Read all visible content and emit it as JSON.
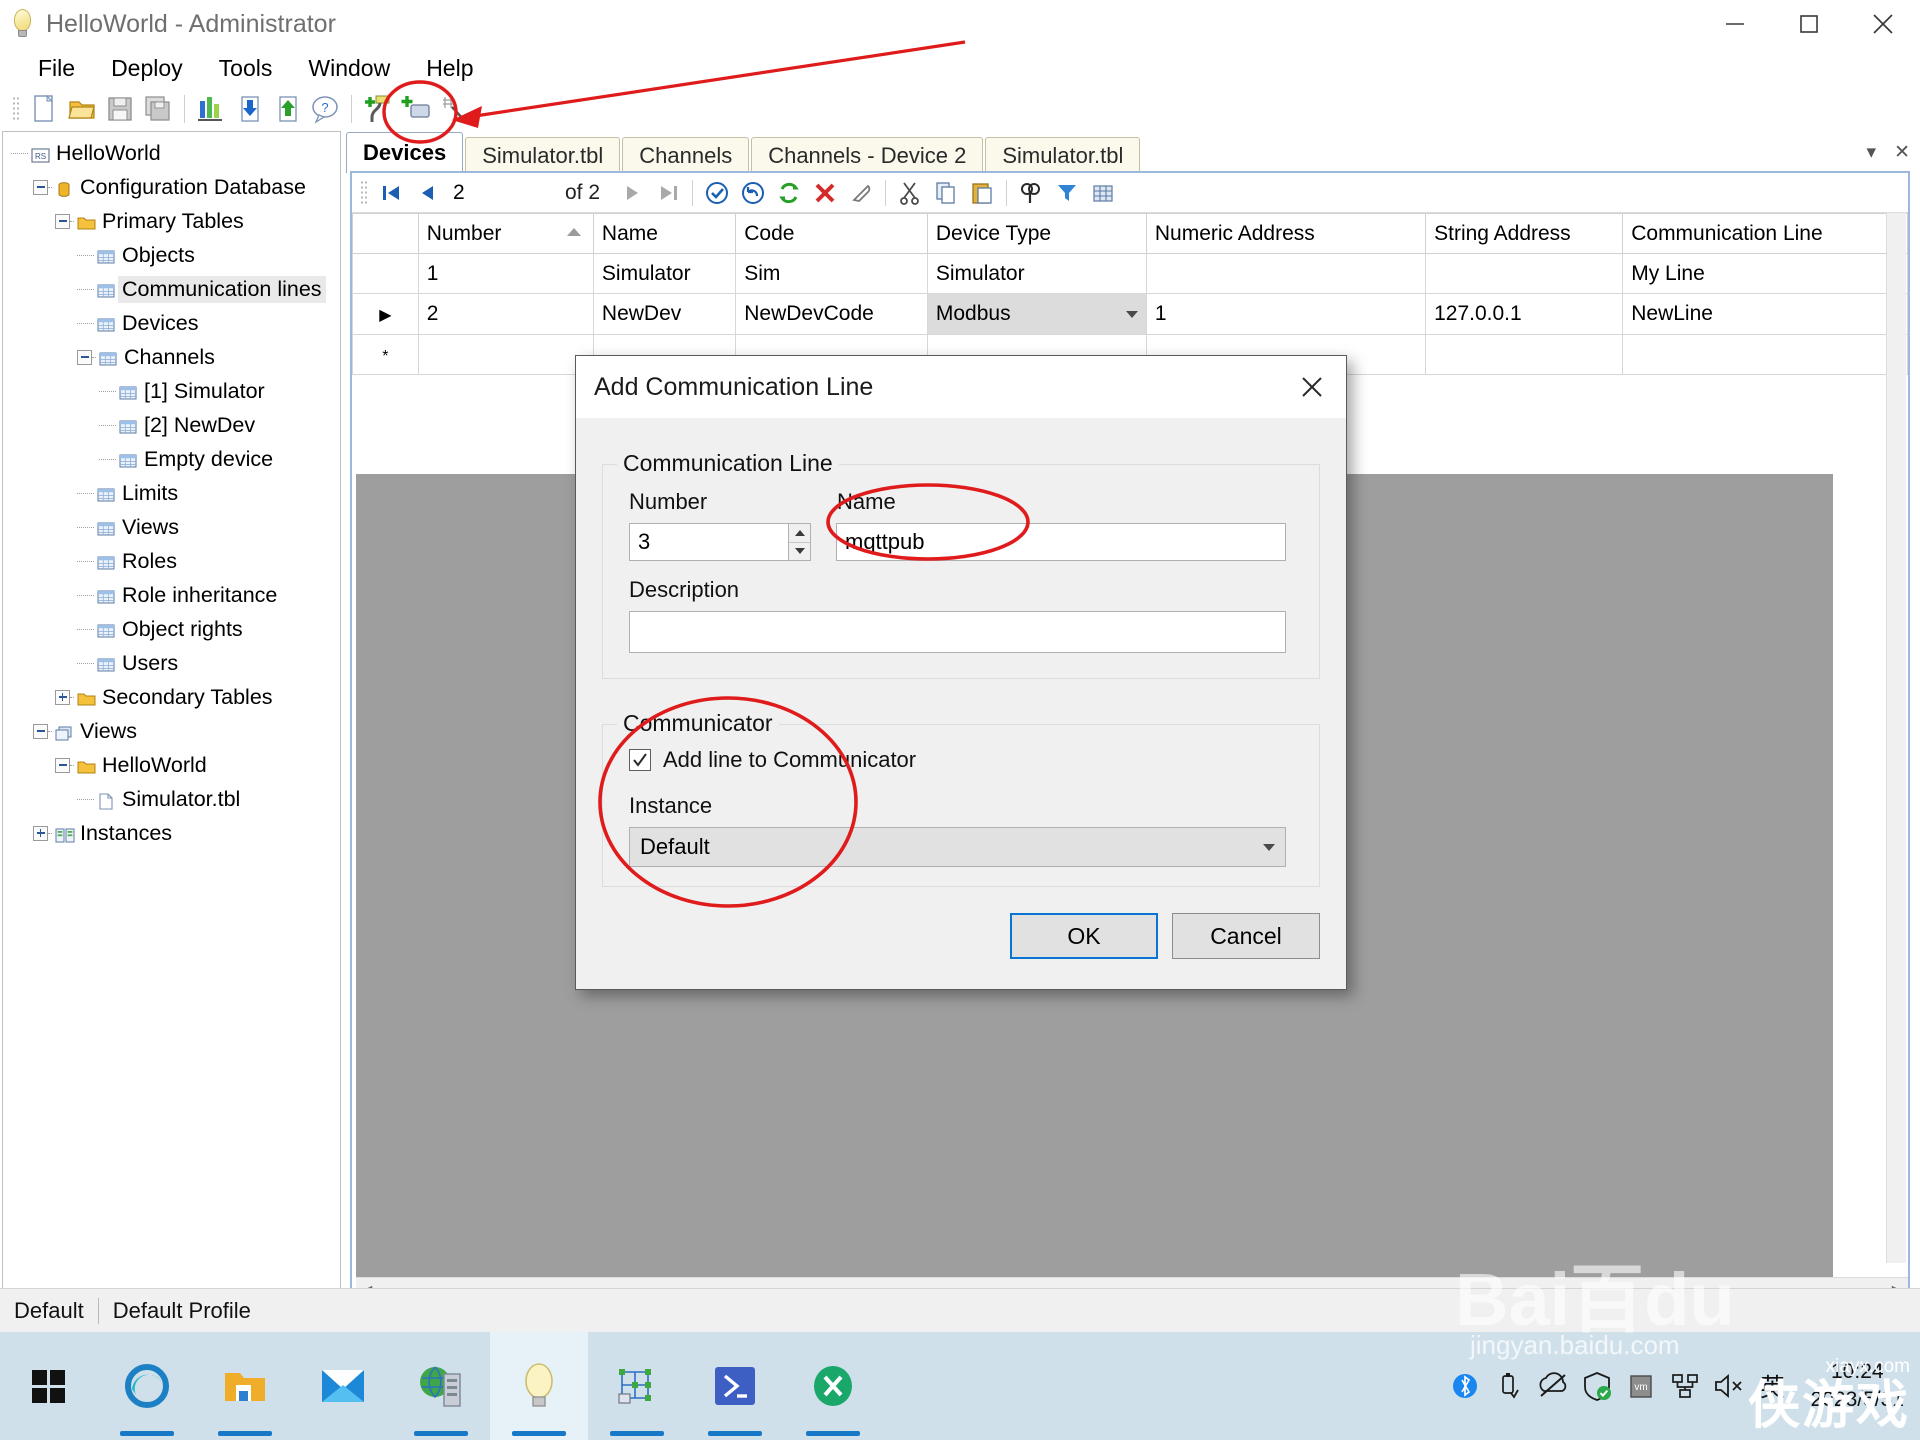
{
  "window": {
    "title": "HelloWorld - Administrator",
    "icon": "lightbulb-icon",
    "minimize": "minimize-icon",
    "maximize": "maximize-icon",
    "close": "close-icon"
  },
  "menubar": {
    "items": [
      {
        "label": "File"
      },
      {
        "label": "Deploy"
      },
      {
        "label": "Tools"
      },
      {
        "label": "Window"
      },
      {
        "label": "Help"
      }
    ]
  },
  "toolbar": {
    "buttons": [
      {
        "name": "new-file-icon"
      },
      {
        "name": "open-folder-icon"
      },
      {
        "name": "save-icon"
      },
      {
        "name": "save-all-icon"
      },
      {
        "name": "statistics-icon"
      },
      {
        "name": "download-icon"
      },
      {
        "name": "upload-icon"
      },
      {
        "name": "help-icon"
      },
      {
        "name": "add-communication-line-icon"
      },
      {
        "name": "add-device-icon"
      },
      {
        "name": "search-tool-icon"
      }
    ]
  },
  "tree": {
    "nodes": [
      {
        "label": "HelloWorld",
        "indent": 0,
        "expander": "none",
        "icon": "project-icon",
        "selected": false
      },
      {
        "label": "Configuration Database",
        "indent": 1,
        "expander": "minus",
        "icon": "database-icon",
        "selected": false
      },
      {
        "label": "Primary Tables",
        "indent": 2,
        "expander": "minus",
        "icon": "folder-icon",
        "selected": false
      },
      {
        "label": "Objects",
        "indent": 3,
        "expander": "none",
        "icon": "table-icon",
        "selected": false
      },
      {
        "label": "Communication lines",
        "indent": 3,
        "expander": "none",
        "icon": "table-icon",
        "selected": true
      },
      {
        "label": "Devices",
        "indent": 3,
        "expander": "none",
        "icon": "table-icon",
        "selected": false
      },
      {
        "label": "Channels",
        "indent": 3,
        "expander": "minus",
        "icon": "table-icon",
        "selected": false
      },
      {
        "label": "[1] Simulator",
        "indent": 4,
        "expander": "none",
        "icon": "table-icon",
        "selected": false
      },
      {
        "label": "[2] NewDev",
        "indent": 4,
        "expander": "none",
        "icon": "table-icon",
        "selected": false
      },
      {
        "label": "Empty device",
        "indent": 4,
        "expander": "none",
        "icon": "table-icon",
        "selected": false
      },
      {
        "label": "Limits",
        "indent": 3,
        "expander": "none",
        "icon": "table-icon",
        "selected": false
      },
      {
        "label": "Views",
        "indent": 3,
        "expander": "none",
        "icon": "table-icon",
        "selected": false
      },
      {
        "label": "Roles",
        "indent": 3,
        "expander": "none",
        "icon": "table-icon",
        "selected": false
      },
      {
        "label": "Role inheritance",
        "indent": 3,
        "expander": "none",
        "icon": "table-icon",
        "selected": false
      },
      {
        "label": "Object rights",
        "indent": 3,
        "expander": "none",
        "icon": "table-icon",
        "selected": false
      },
      {
        "label": "Users",
        "indent": 3,
        "expander": "none",
        "icon": "table-icon",
        "selected": false
      },
      {
        "label": "Secondary Tables",
        "indent": 2,
        "expander": "plus",
        "icon": "folder-icon",
        "selected": false
      },
      {
        "label": "Views",
        "indent": 1,
        "expander": "minus",
        "icon": "views-icon",
        "selected": false
      },
      {
        "label": "HelloWorld",
        "indent": 2,
        "expander": "minus",
        "icon": "folder-icon",
        "selected": false
      },
      {
        "label": "Simulator.tbl",
        "indent": 3,
        "expander": "none",
        "icon": "file-icon",
        "selected": false
      },
      {
        "label": "Instances",
        "indent": 1,
        "expander": "plus",
        "icon": "instances-icon",
        "selected": false
      }
    ]
  },
  "tabs": {
    "items": [
      {
        "label": "Devices",
        "active": true
      },
      {
        "label": "Simulator.tbl",
        "active": false
      },
      {
        "label": "Channels",
        "active": false
      },
      {
        "label": "Channels - Device 2",
        "active": false
      },
      {
        "label": "Simulator.tbl",
        "active": false
      }
    ],
    "dropdown_icon": "chevron-down-icon",
    "close_icon": "close-icon"
  },
  "grid_toolbar": {
    "first_icon": "first-record-icon",
    "prev_icon": "previous-record-icon",
    "record_number": "2",
    "of_label": "of 2",
    "next_icon": "next-record-icon",
    "last_icon": "last-record-icon",
    "accept_icon": "accept-icon",
    "undo_icon": "undo-icon",
    "refresh_icon": "refresh-icon",
    "delete_icon": "delete-icon",
    "clear_icon": "clear-icon",
    "cut_icon": "cut-icon",
    "copy_icon": "copy-icon",
    "paste_icon": "paste-icon",
    "find_icon": "find-icon",
    "filter_icon": "filter-icon",
    "autofit_icon": "auto-fit-columns-icon"
  },
  "grid": {
    "columns": [
      "Number",
      "Name",
      "Code",
      "Device Type",
      "Numeric Address",
      "String Address",
      "Communication Line"
    ],
    "sort_column": "Number",
    "sort_direction": "ascending",
    "rows": [
      {
        "marker": "",
        "Number": "1",
        "Name": "Simulator",
        "Code": "Sim",
        "Device Type": "Simulator",
        "Numeric Address": "",
        "String Address": "",
        "Communication Line": "My Line",
        "editing": false
      },
      {
        "marker": "▶",
        "Number": "2",
        "Name": "NewDev",
        "Code": "NewDevCode",
        "Device Type": "Modbus",
        "Numeric Address": "1",
        "String Address": "127.0.0.1",
        "Communication Line": "NewLine",
        "editing": true
      },
      {
        "marker": "*",
        "Number": "",
        "Name": "",
        "Code": "",
        "Device Type": "",
        "Numeric Address": "",
        "String Address": "",
        "Communication Line": "",
        "editing": false
      }
    ]
  },
  "dialog": {
    "title": "Add Communication Line",
    "close_icon": "close-icon",
    "group_line": {
      "title": "Communication Line",
      "number_label": "Number",
      "number_value": "3",
      "name_label": "Name",
      "name_value": "mqttpub",
      "description_label": "Description",
      "description_value": ""
    },
    "group_communicator": {
      "title": "Communicator",
      "checkbox_label": "Add line to Communicator",
      "checkbox_checked": true,
      "instance_label": "Instance",
      "instance_value": "Default",
      "instance_options": [
        "Default"
      ]
    },
    "ok_label": "OK",
    "cancel_label": "Cancel"
  },
  "statusbar": {
    "left": "Default",
    "right": "Default Profile"
  },
  "taskbar": {
    "items": [
      {
        "name": "start-button-icon",
        "active": false,
        "running": false
      },
      {
        "name": "edge-browser-icon",
        "active": false,
        "running": true
      },
      {
        "name": "file-explorer-icon",
        "active": false,
        "running": true
      },
      {
        "name": "mail-icon",
        "active": false,
        "running": false
      },
      {
        "name": "server-globe-icon",
        "active": false,
        "running": true
      },
      {
        "name": "scada-administrator-icon",
        "active": true,
        "running": true
      },
      {
        "name": "communicator-icon",
        "active": false,
        "running": true
      },
      {
        "name": "powershell-icon",
        "active": false,
        "running": true
      },
      {
        "name": "xshell-icon",
        "active": false,
        "running": true
      }
    ],
    "tray": [
      {
        "name": "bluetooth-icon"
      },
      {
        "name": "usb-eject-icon"
      },
      {
        "name": "no-sync-icon"
      },
      {
        "name": "security-shield-icon"
      },
      {
        "name": "vm-icon"
      },
      {
        "name": "network-icon"
      },
      {
        "name": "volume-muted-icon"
      },
      {
        "name": "ime-language-icon",
        "label": "英"
      }
    ],
    "clock_time": "10:24",
    "clock_date": "2023/5/31"
  },
  "watermarks": {
    "baidu_text": "jingyan.baidu.com",
    "baidu_brand": "Bai百du",
    "xiayx": "xiayx.com",
    "hero": "侠游戏"
  },
  "annotations": {
    "accent_color": "#e01b1b",
    "marks": [
      {
        "type": "ellipse",
        "target": "add-communication-line-toolbar-button"
      },
      {
        "type": "arrow",
        "target": "add-communication-line-toolbar-button"
      },
      {
        "type": "ellipse",
        "target": "dialog-name-field"
      },
      {
        "type": "ellipse",
        "target": "dialog-communicator-group"
      }
    ]
  }
}
